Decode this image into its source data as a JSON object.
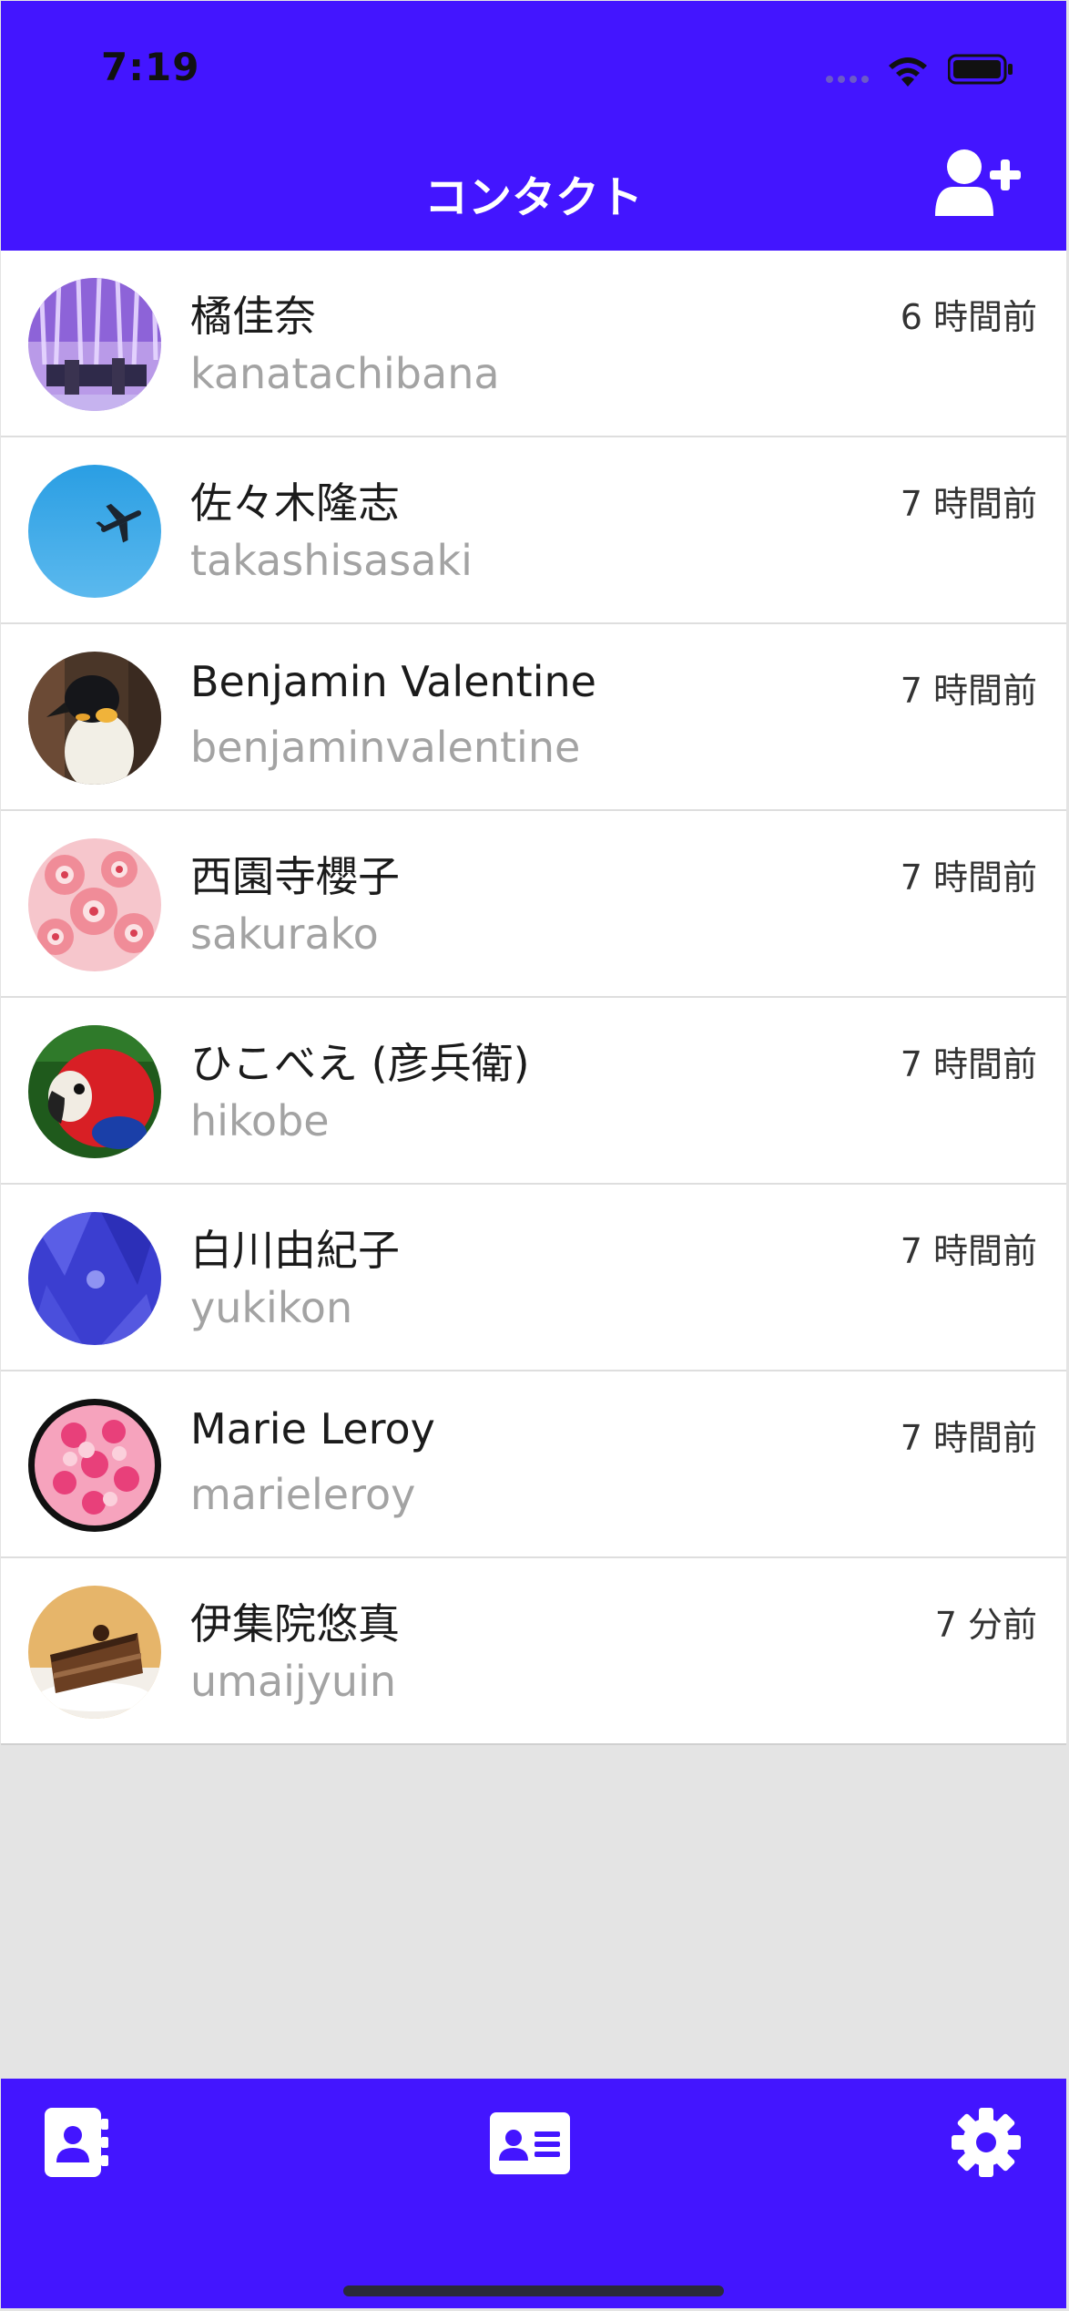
{
  "status_bar": {
    "time": "7:19"
  },
  "header": {
    "title": "コンタクト",
    "add_icon": "add-user-icon"
  },
  "contacts": [
    {
      "name": "橘佳奈",
      "id": "kanatachibana",
      "time": "6 時間前",
      "avatar": "wisteria-photo"
    },
    {
      "name": "佐々木隆志",
      "id": "takashisasaki",
      "time": "7 時間前",
      "avatar": "airplane-sky-photo"
    },
    {
      "name": "Benjamin Valentine",
      "id": "benjaminvalentine",
      "time": "7 時間前",
      "avatar": "penguin-photo"
    },
    {
      "name": "西園寺櫻子",
      "id": "sakurako",
      "time": "7 時間前",
      "avatar": "cherry-blossom-photo"
    },
    {
      "name": "ひこべえ (彦兵衛)",
      "id": "hikobe",
      "time": "7 時間前",
      "avatar": "parrot-photo"
    },
    {
      "name": "白川由紀子",
      "id": "yukikon",
      "time": "7 時間前",
      "avatar": "hydrangea-photo"
    },
    {
      "name": "Marie Leroy",
      "id": "marieleroy",
      "time": "7 時間前",
      "avatar": "roses-photo"
    },
    {
      "name": "伊集院悠真",
      "id": "umaijyuin",
      "time": "7 分前",
      "avatar": "cake-photo"
    }
  ],
  "tab_bar": {
    "tabs": [
      {
        "name": "contacts",
        "icon": "address-book-icon"
      },
      {
        "name": "profile",
        "icon": "id-card-icon"
      },
      {
        "name": "settings",
        "icon": "gear-icon"
      }
    ]
  },
  "colors": {
    "accent": "#4315ff",
    "background": "#e4e4e4",
    "secondary_text": "#a3a3a3"
  }
}
